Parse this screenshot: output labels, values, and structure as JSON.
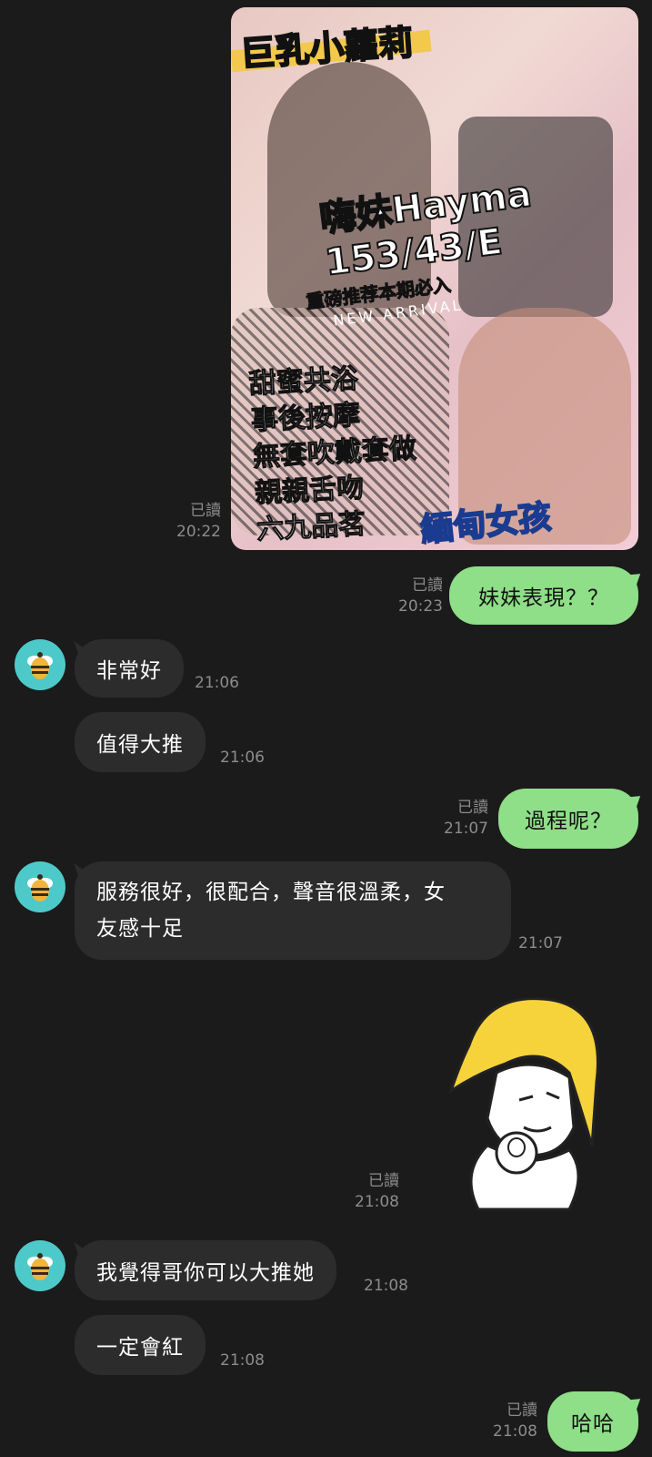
{
  "photo_message": {
    "title": "巨乳小蘿莉",
    "name_line": "嗨妹Hayma",
    "stats_line": "153/43/E",
    "promo": "重磅推荐本期必入",
    "tagline": "NEW ARRIVAL",
    "services": [
      "甜蜜共浴",
      "事後按摩",
      "無套吹戴套做",
      "親親舌吻",
      "六九品茗"
    ],
    "type_label": "緬甸女孩",
    "read": "已讀",
    "time": "20:22"
  },
  "messages": [
    {
      "from": "me",
      "text": "妹妹表現？？",
      "read": "已讀",
      "time": "20:23"
    },
    {
      "from": "them",
      "text": "非常好",
      "time": "21:06"
    },
    {
      "from": "them",
      "text": "值得大推",
      "time": "21:06"
    },
    {
      "from": "me",
      "text": "過程呢？",
      "read": "已讀",
      "time": "21:07"
    },
    {
      "from": "them",
      "text_line1": "服務很好，很配合，聲音很溫柔，女",
      "text_line2": "友感十足",
      "time": "21:07"
    },
    {
      "from": "me",
      "sticker": "pointing-character-sticker",
      "read": "已讀",
      "time": "21:08"
    },
    {
      "from": "them",
      "text": "我覺得哥你可以大推她",
      "time": "21:08"
    },
    {
      "from": "them",
      "text": "一定會紅",
      "time": "21:08"
    },
    {
      "from": "me",
      "text": "哈哈",
      "read": "已讀",
      "time": "21:08"
    }
  ],
  "colors": {
    "background": "#1b1b1b",
    "outgoing": "#8fde88",
    "incoming": "#2c2c2c",
    "avatar": "#4ec9c9"
  },
  "icons": {
    "avatar": "bee-icon"
  }
}
